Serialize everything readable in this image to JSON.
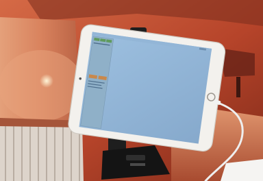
{
  "scene": {
    "description_tags": [
      "tablet-on-stand",
      "orange-cabinet",
      "charging-cable"
    ]
  },
  "tablet": {
    "status_bar": {
      "time": "",
      "battery": ""
    },
    "sidebar": {
      "top_buttons": [
        "",
        "",
        ""
      ],
      "title_line": "",
      "bottom_buttons": [
        "",
        ""
      ],
      "list_lines": [
        "",
        "",
        ""
      ]
    }
  },
  "colors": {
    "screen": "#8fb3d6",
    "screen_dark": "#7ea2c6",
    "sidebar_panel": "#8fb0c8",
    "button_green": "#5f9b5e",
    "button_orange": "#c9884b",
    "bezel": "#f3f1ed",
    "cabinet": "#d9835e",
    "wall": "#b6442a",
    "cable": "#eeeeee",
    "stand": "#1e1e1e"
  }
}
